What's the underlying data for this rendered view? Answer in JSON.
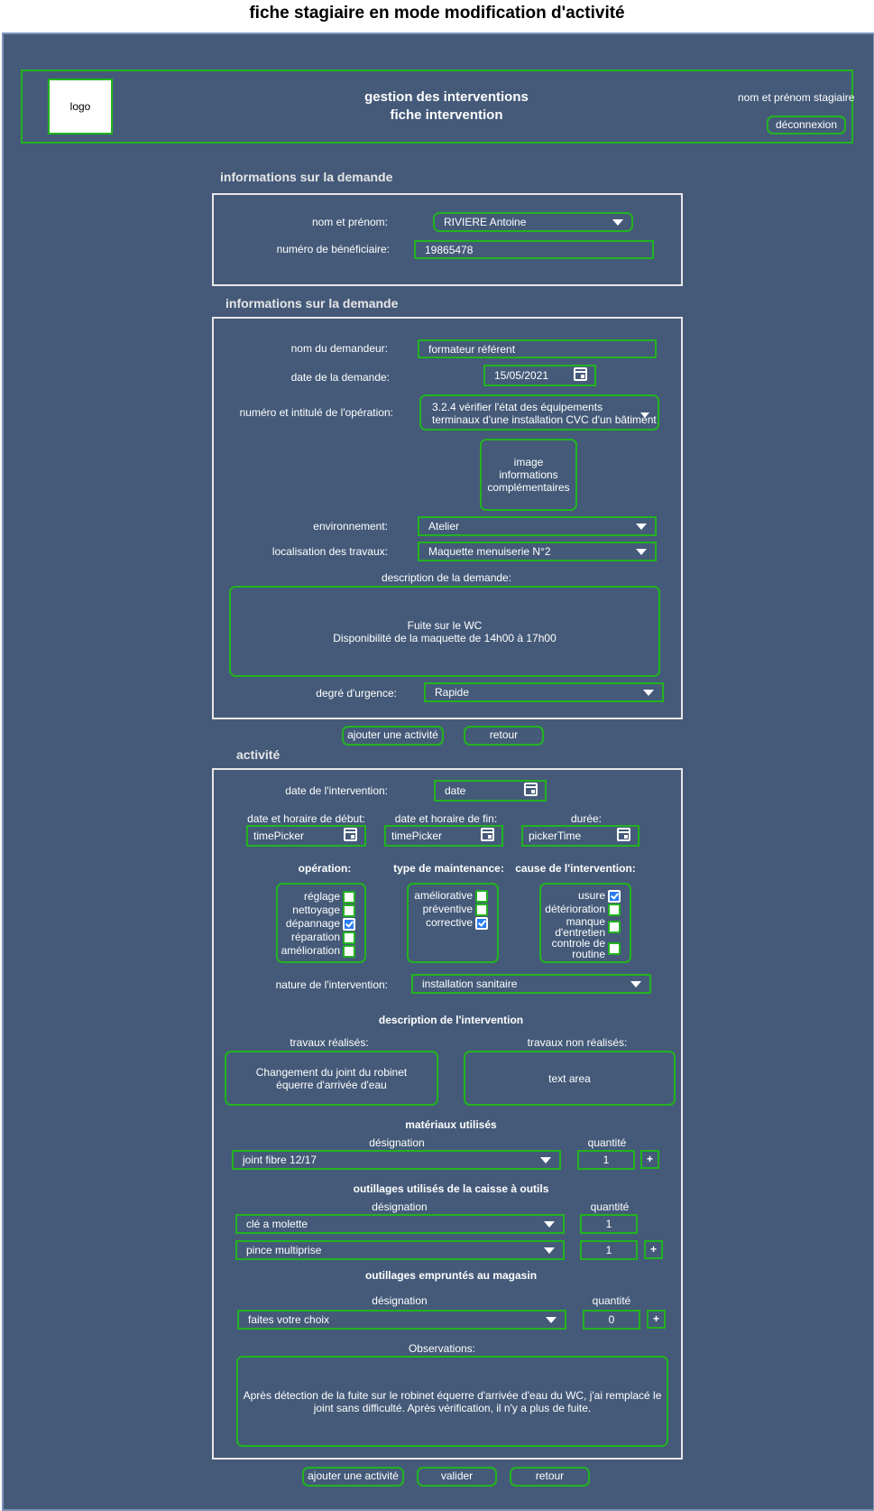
{
  "page_title": "fiche stagiaire en mode modification d'activité",
  "header": {
    "logo": "logo",
    "app_title_line1": "gestion des interventions",
    "app_title_line2": "fiche intervention",
    "user_label": "nom et prénom stagiaire",
    "logout_label": "déconnexion"
  },
  "section1": {
    "title": "informations sur la demande",
    "name_label": "nom et prénom:",
    "name_value": "RIVIERE Antoine",
    "beneficiary_label": "numéro de bénéficiaire:",
    "beneficiary_value": "19865478"
  },
  "section2": {
    "title": "informations sur la demande",
    "requester_label": "nom du demandeur:",
    "requester_value": "formateur référent",
    "request_date_label": "date de la demande:",
    "request_date_value": "15/05/2021",
    "operation_label": "numéro et intitulé de l'opération:",
    "operation_value_line1": "3.2.4 vérifier l'état des équipements",
    "operation_value_line2": "terminaux d'une installation CVC d'un bâtiment",
    "image_line1": "image",
    "image_line2": "informations",
    "image_line3": "complémentaires",
    "environment_label": "environnement:",
    "environment_value": "Atelier",
    "location_label": "localisation des travaux:",
    "location_value": "Maquette menuiserie N°2",
    "description_label": "description de la demande:",
    "description_line1": "Fuite sur le WC",
    "description_line2": "Disponibilité de la maquette de 14h00 à 17h00",
    "urgency_label": "degré d'urgence:",
    "urgency_value": "Rapide"
  },
  "mid_buttons": {
    "add_activity": "ajouter une activité",
    "back": "retour"
  },
  "activity": {
    "title": "activité",
    "intervention_date_label": "date de l'intervention:",
    "intervention_date_value": "date",
    "start_label": "date et horaire de début:",
    "start_value": "timePicker",
    "end_label": "date et horaire de fin:",
    "end_value": "timePicker",
    "duration_label": "durée:",
    "duration_value": "pickerTime",
    "operation_title": "opération:",
    "operation_items": [
      {
        "label": "réglage",
        "checked": false
      },
      {
        "label": "nettoyage",
        "checked": false
      },
      {
        "label": "dépannage",
        "checked": true
      },
      {
        "label": "réparation",
        "checked": false
      },
      {
        "label": "amélioration",
        "checked": false
      }
    ],
    "maintenance_title": "type de maintenance:",
    "maintenance_items": [
      {
        "label": "améliorative",
        "checked": false
      },
      {
        "label": "préventive",
        "checked": false
      },
      {
        "label": "corrective",
        "checked": true
      }
    ],
    "cause_title": "cause de l'intervention:",
    "cause_items": [
      {
        "label": "usure",
        "checked": true
      },
      {
        "label": "détérioration",
        "checked": false
      },
      {
        "label": "manque d'entretien",
        "checked": false
      },
      {
        "label": "controle de routine",
        "checked": false
      }
    ],
    "nature_label": "nature de l'intervention:",
    "nature_value": "installation sanitaire",
    "description_title": "description de l'intervention",
    "done_label": "travaux réalisés:",
    "done_line1": "Changement du joint du robinet",
    "done_line2": "équerre d'arrivée d'eau",
    "not_done_label": "travaux non réalisés:",
    "not_done_value": "text area",
    "materials_title": "matériaux utilisés",
    "materials_designation_label": "désignation",
    "materials_quantity_label": "quantité",
    "materials_row": {
      "designation": "joint fibre 12/17",
      "quantity": "1"
    },
    "tools_title": "outillages utilisés de la caisse à outils",
    "tools_designation_label": "désignation",
    "tools_quantity_label": "quantité",
    "tools_rows": [
      {
        "designation": "clé a molette",
        "quantity": "1"
      },
      {
        "designation": "pince multiprise",
        "quantity": "1"
      }
    ],
    "borrowed_title": "outillages empruntés au magasin",
    "borrowed_designation_label": "désignation",
    "borrowed_quantity_label": "quantité",
    "borrowed_row": {
      "designation": "faites votre choix",
      "quantity": "0"
    },
    "plus_label": "+",
    "observations_label": "Observations:",
    "observations_line1": "Après détection de la fuite sur le robinet équerre d'arrivée d'eau du WC, j'ai remplacé le",
    "observations_line2": "joint sans difficulté. Après vérification, il n'y a plus de fuite."
  },
  "bottom_buttons": {
    "add_activity": "ajouter une activité",
    "validate": "valider",
    "back": "retour"
  },
  "colors": {
    "background": "#455a79",
    "accent_border": "#22b31f",
    "panel_border": "#e8e8e8"
  }
}
